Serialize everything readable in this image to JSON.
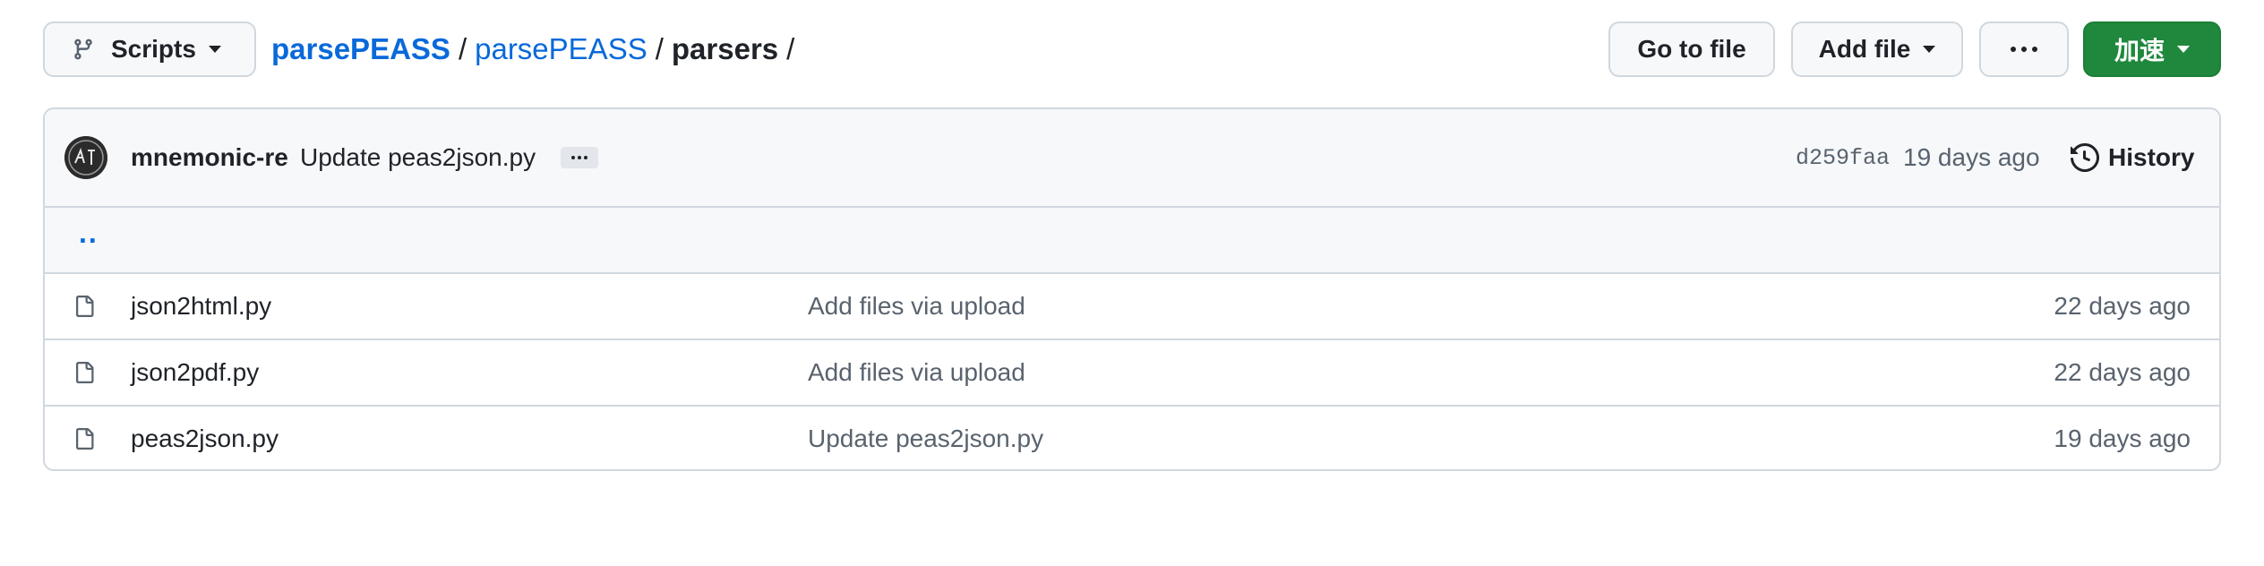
{
  "toolbar": {
    "branch": "Scripts",
    "breadcrumb": [
      "parsePEASS",
      "parsePEASS",
      "parsers"
    ],
    "separator": "/",
    "go_to_file": "Go to file",
    "add_file": "Add file",
    "speed": "加速",
    "speed_color": "#1f883d"
  },
  "commit": {
    "author": "mnemonic-re",
    "message": "Update peas2json.py",
    "hash": "d259faa",
    "age": "19 days ago",
    "history_label": "History"
  },
  "parent_dir": "..",
  "files": [
    {
      "name": "json2html.py",
      "message": "Add files via upload",
      "age": "22 days ago",
      "icon": "file-icon"
    },
    {
      "name": "json2pdf.py",
      "message": "Add files via upload",
      "age": "22 days ago",
      "icon": "file-icon"
    },
    {
      "name": "peas2json.py",
      "message": "Update peas2json.py",
      "age": "19 days ago",
      "icon": "file-icon"
    }
  ]
}
